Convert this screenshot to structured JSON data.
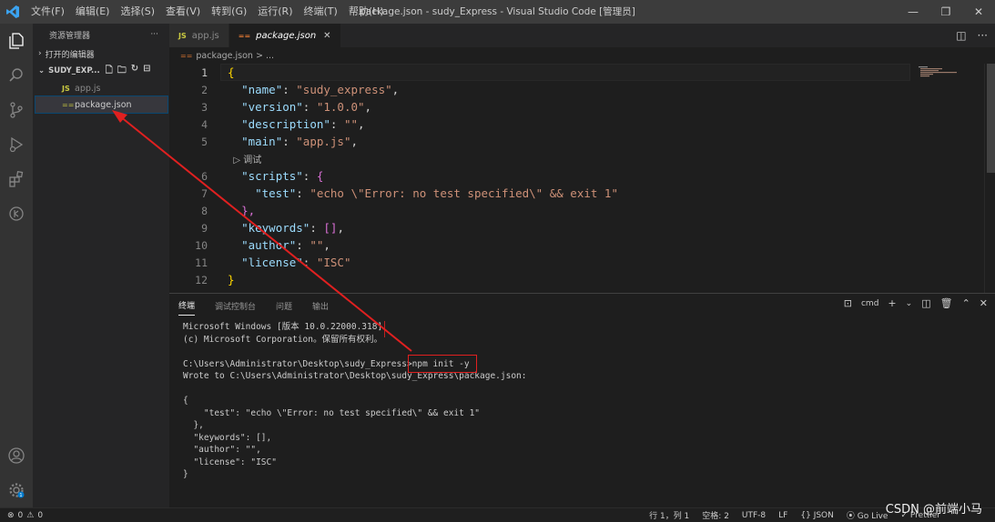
{
  "titlebar": {
    "menus": [
      "文件(F)",
      "编辑(E)",
      "选择(S)",
      "查看(V)",
      "转到(G)",
      "运行(R)",
      "终端(T)",
      "帮助(H)"
    ],
    "window_title": "package.json - sudy_Express - Visual Studio Code [管理员]"
  },
  "sidebar": {
    "title": "资源管理器",
    "more": "···",
    "open_editors": "打开的编辑器",
    "folder": "SUDY_EXP...",
    "files": [
      {
        "badge": "JS",
        "name": "app.js"
      },
      {
        "badge": "==",
        "name": "package.json"
      }
    ]
  },
  "tabs": [
    {
      "badge": "JS",
      "label": "app.js"
    },
    {
      "badge": "==",
      "label": "package.json",
      "close": "✕"
    }
  ],
  "breadcrumb": "package.json > ...",
  "editor": {
    "line_numbers": [
      "1",
      "2",
      "3",
      "4",
      "5",
      "",
      "6",
      "7",
      "8",
      "9",
      "10",
      "11",
      "12"
    ],
    "codelens": "▷ 调试",
    "lines": [
      [
        {
          "t": "{",
          "c": "b"
        }
      ],
      [
        {
          "t": "  "
        },
        {
          "t": "\"name\"",
          "c": "k"
        },
        {
          "t": ": ",
          "c": "p"
        },
        {
          "t": "\"sudy_express\"",
          "c": "s"
        },
        {
          "t": ",",
          "c": "p"
        }
      ],
      [
        {
          "t": "  "
        },
        {
          "t": "\"version\"",
          "c": "k"
        },
        {
          "t": ": ",
          "c": "p"
        },
        {
          "t": "\"1.0.0\"",
          "c": "s"
        },
        {
          "t": ",",
          "c": "p"
        }
      ],
      [
        {
          "t": "  "
        },
        {
          "t": "\"description\"",
          "c": "k"
        },
        {
          "t": ": ",
          "c": "p"
        },
        {
          "t": "\"\"",
          "c": "s"
        },
        {
          "t": ",",
          "c": "p"
        }
      ],
      [
        {
          "t": "  "
        },
        {
          "t": "\"main\"",
          "c": "k"
        },
        {
          "t": ": ",
          "c": "p"
        },
        {
          "t": "\"app.js\"",
          "c": "s"
        },
        {
          "t": ",",
          "c": "p"
        }
      ],
      [],
      [
        {
          "t": "  "
        },
        {
          "t": "\"scripts\"",
          "c": "k"
        },
        {
          "t": ": ",
          "c": "p"
        },
        {
          "t": "{",
          "c": "sq"
        }
      ],
      [
        {
          "t": "    "
        },
        {
          "t": "\"test\"",
          "c": "k"
        },
        {
          "t": ": ",
          "c": "p"
        },
        {
          "t": "\"echo \\\"Error: no test specified\\\" && exit 1\"",
          "c": "s"
        }
      ],
      [
        {
          "t": "  "
        },
        {
          "t": "},",
          "c": "sq"
        }
      ],
      [
        {
          "t": "  "
        },
        {
          "t": "\"keywords\"",
          "c": "k"
        },
        {
          "t": ": ",
          "c": "p"
        },
        {
          "t": "[]",
          "c": "sq"
        },
        {
          "t": ",",
          "c": "p"
        }
      ],
      [
        {
          "t": "  "
        },
        {
          "t": "\"author\"",
          "c": "k"
        },
        {
          "t": ": ",
          "c": "p"
        },
        {
          "t": "\"\"",
          "c": "s"
        },
        {
          "t": ",",
          "c": "p"
        }
      ],
      [
        {
          "t": "  "
        },
        {
          "t": "\"license\"",
          "c": "k"
        },
        {
          "t": ": ",
          "c": "p"
        },
        {
          "t": "\"ISC\"",
          "c": "s"
        }
      ],
      [
        {
          "t": "}",
          "c": "b"
        }
      ]
    ]
  },
  "panel": {
    "tabs": [
      "终端",
      "调试控制台",
      "问题",
      "输出"
    ],
    "shell": "cmd",
    "terminal_lines": [
      "Microsoft Windows [版本 10.0.22000.318]",
      "(c) Microsoft Corporation。保留所有权利。",
      "",
      "C:\\Users\\Administrator\\Desktop\\sudy_Express>npm init -y",
      "Wrote to C:\\Users\\Administrator\\Desktop\\sudy_Express\\package.json:",
      "",
      "{",
      "    \"test\": \"echo \\\"Error: no test specified\\\" && exit 1\"",
      "  },",
      "  \"keywords\": [],",
      "  \"author\": \"\",",
      "  \"license\": \"ISC\"",
      "}"
    ]
  },
  "statusbar": {
    "errors": "0",
    "warnings": "0",
    "position": "行 1，列 1",
    "spaces": "空格: 2",
    "encoding": "UTF-8",
    "eol": "LF",
    "language": "{} JSON",
    "golive": "Go Live",
    "prettier": "Prettier"
  },
  "watermark": "CSDN @前端小马",
  "colors": {
    "annotation": "#e02020",
    "accent": "#007acc"
  }
}
